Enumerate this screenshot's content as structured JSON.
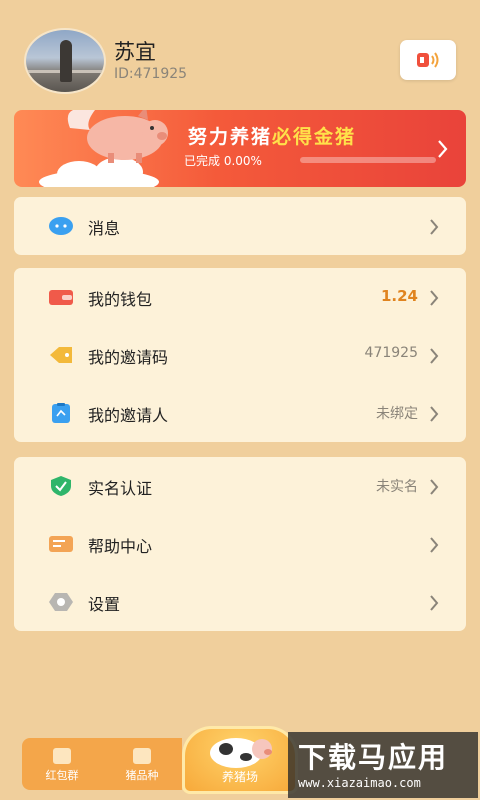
{
  "profile": {
    "name": "苏宜",
    "id_label": "ID:471925"
  },
  "banner": {
    "title_part1": "努力养猪",
    "title_part2": "必得金猪",
    "progress_label": "已完成 0.00%",
    "progress_fraction": 0.0
  },
  "sections": [
    {
      "rows": [
        {
          "label": "消息",
          "value": "",
          "icon": "chat-bubble-icon"
        }
      ]
    },
    {
      "rows": [
        {
          "label": "我的钱包",
          "value": "1.24",
          "icon": "wallet-icon"
        },
        {
          "label": "我的邀请码",
          "value": "471925",
          "icon": "tag-icon"
        },
        {
          "label": "我的邀请人",
          "value": "未绑定",
          "icon": "clipboard-icon"
        }
      ]
    },
    {
      "rows": [
        {
          "label": "实名认证",
          "value": "未实名",
          "icon": "shield-icon"
        },
        {
          "label": "帮助中心",
          "value": "",
          "icon": "help-book-icon"
        },
        {
          "label": "设置",
          "value": "",
          "icon": "hexagon-settings-icon"
        }
      ]
    }
  ],
  "tabs": {
    "t1": "红包群",
    "t2": "猪品种",
    "center": "养猪场"
  },
  "watermark": {
    "big": "下载马应用",
    "small": "www.xiazaimao.com"
  },
  "colors": {
    "page_bg": "#f0cf9c",
    "card_bg": "#fdf2d9",
    "banner_start": "#ff8a55",
    "banner_end": "#e9433a",
    "accent_value": "#e0841f",
    "tab_bg": "#f4a64a"
  }
}
